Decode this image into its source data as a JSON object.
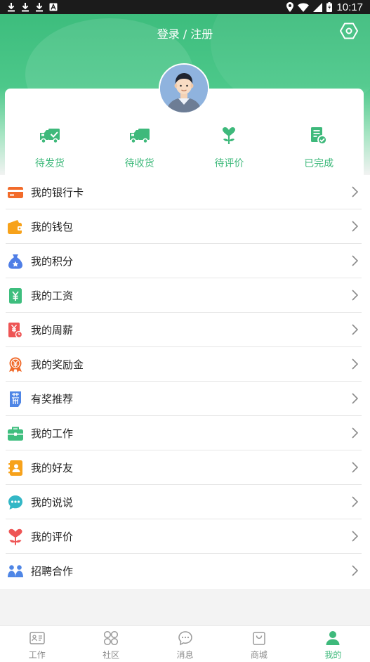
{
  "status_bar": {
    "time": "10:17"
  },
  "header": {
    "login_register": "登录 / 注册"
  },
  "orders": [
    {
      "label": "待发货",
      "icon": "truck-check-icon"
    },
    {
      "label": "待收货",
      "icon": "delivery-truck-icon"
    },
    {
      "label": "待评价",
      "icon": "heart-plant-icon"
    },
    {
      "label": "已完成",
      "icon": "document-check-icon"
    }
  ],
  "menu": [
    {
      "label": "我的银行卡",
      "icon": "bank-card-icon",
      "color": "#f26b2a"
    },
    {
      "label": "我的钱包",
      "icon": "wallet-icon",
      "color": "#f7a21b"
    },
    {
      "label": "我的积分",
      "icon": "points-bag-icon",
      "color": "#4f7ee6"
    },
    {
      "label": "我的工资",
      "icon": "salary-icon",
      "color": "#3ebe7e"
    },
    {
      "label": "我的周薪",
      "icon": "weekly-pay-icon",
      "color": "#ee5555"
    },
    {
      "label": "我的奖励金",
      "icon": "reward-medal-icon",
      "color": "#f06a2a"
    },
    {
      "label": "有奖推荐",
      "icon": "recommend-icon",
      "color": "#4f86e6"
    },
    {
      "label": "我的工作",
      "icon": "briefcase-icon",
      "color": "#3ebe7e"
    },
    {
      "label": "我的好友",
      "icon": "contacts-icon",
      "color": "#f7a21b"
    },
    {
      "label": "我的说说",
      "icon": "chat-bubble-icon",
      "color": "#33b7c6"
    },
    {
      "label": "我的评价",
      "icon": "heart-flower-icon",
      "color": "#ee5555"
    },
    {
      "label": "招聘合作",
      "icon": "people-icon",
      "color": "#4f86e6"
    }
  ],
  "bottom_nav": [
    {
      "label": "工作",
      "icon": "id-card-icon",
      "active": false
    },
    {
      "label": "社区",
      "icon": "community-grid-icon",
      "active": false
    },
    {
      "label": "消息",
      "icon": "message-bubble-icon",
      "active": false
    },
    {
      "label": "商城",
      "icon": "shopping-bag-icon",
      "active": false
    },
    {
      "label": "我的",
      "icon": "person-icon",
      "active": true
    }
  ],
  "colors": {
    "brand_green": "#3eb97b",
    "header_top": "#3dbd7d",
    "background": "#f3f3f3"
  }
}
